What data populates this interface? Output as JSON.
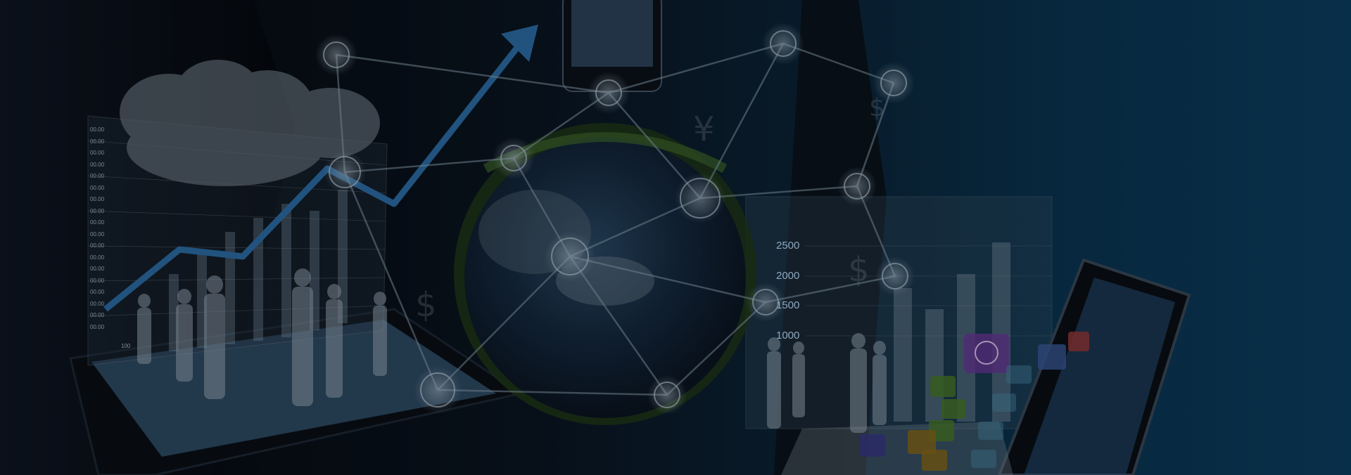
{
  "scene": {
    "description_colors": {
      "background_dark": "#05080d",
      "background_blue": "#0b3f63",
      "network_line": "#8fa7b8",
      "globe_green": "#2f5a2a"
    },
    "right_chart_ticks": [
      "2500",
      "2000",
      "1500",
      "1000"
    ],
    "left_chart_ticks": [
      "00.00",
      "00.00",
      "00.00",
      "00.00",
      "00.00",
      "00.00",
      "00.00",
      "00.00",
      "00.00",
      "00.00",
      "00.00",
      "00.00",
      "00.00",
      "00.00",
      "00.00",
      "00.00",
      "00.00",
      "00.00"
    ],
    "left_chart_bottom_label": "100",
    "icons": [
      "people-icon",
      "globe-icon",
      "mail-icon",
      "cart-icon",
      "video-icon",
      "music-icon",
      "airplane-icon",
      "dollar-icon",
      "yen-icon"
    ]
  }
}
